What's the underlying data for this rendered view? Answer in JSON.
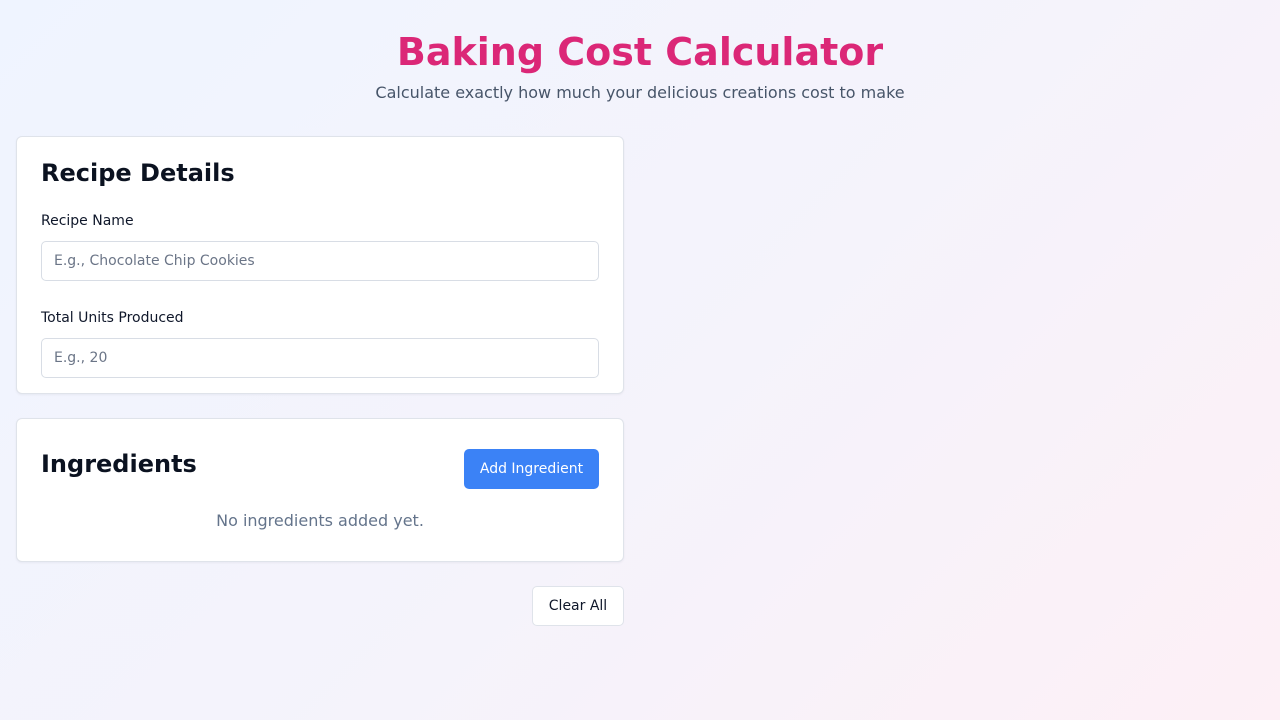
{
  "header": {
    "title": "Baking Cost Calculator",
    "subtitle": "Calculate exactly how much your delicious creations cost to make"
  },
  "recipe_details": {
    "title": "Recipe Details",
    "recipe_name": {
      "label": "Recipe Name",
      "value": "",
      "placeholder": "E.g., Chocolate Chip Cookies"
    },
    "total_units": {
      "label": "Total Units Produced",
      "value": "",
      "placeholder": "E.g., 20"
    }
  },
  "ingredients": {
    "title": "Ingredients",
    "add_button_label": "Add Ingredient",
    "empty_message": "No ingredients added yet."
  },
  "actions": {
    "clear_all_label": "Clear All"
  },
  "colors": {
    "title_pink": "#db2777",
    "accent_blue": "#3b82f6"
  }
}
